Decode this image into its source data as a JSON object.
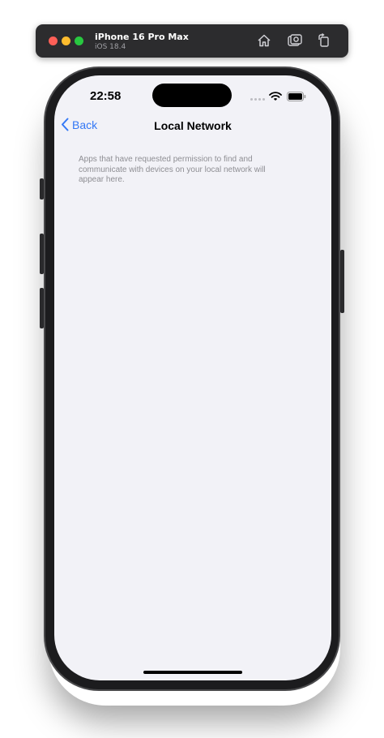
{
  "simulator": {
    "device_name": "iPhone 16 Pro Max",
    "os_version": "iOS 18.4",
    "toolbar_icons": [
      "home-icon",
      "screenshot-icon",
      "rotate-icon"
    ]
  },
  "status_bar": {
    "time": "22:58",
    "icons": [
      "wifi-icon",
      "battery-icon"
    ]
  },
  "nav": {
    "back_label": "Back",
    "title": "Local Network"
  },
  "main": {
    "description": "Apps that have requested permission to find and communicate with devices on your local network will appear here."
  },
  "colors": {
    "accent": "#3478f6",
    "background": "#f2f2f7",
    "secondary_text": "#8e8e93"
  }
}
